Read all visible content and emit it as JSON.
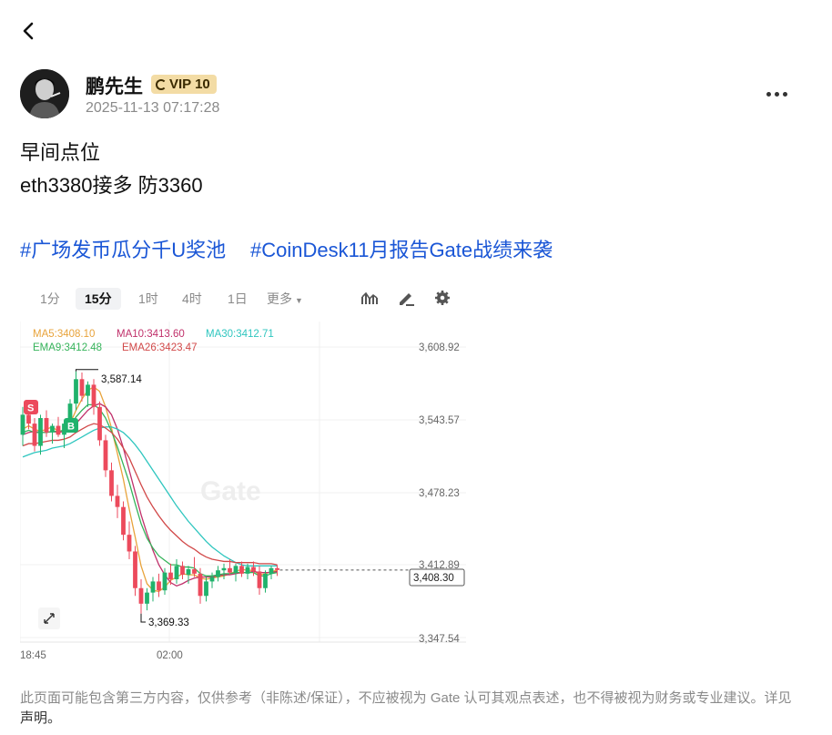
{
  "header": {
    "back_icon": "chevron-left-icon",
    "more_icon": "more-horizontal-icon"
  },
  "author": {
    "name": "鹏先生",
    "vip_label": "VIP 10",
    "timestamp": "2025-11-13 07:17:28"
  },
  "post": {
    "lines": [
      "早间点位",
      "eth3380接多 防3360"
    ],
    "hashtags": [
      "#广场发币瓜分千U奖池",
      "#CoinDesk11月报告Gate战绩来袭"
    ]
  },
  "chart_toolbar": {
    "timeframes": [
      "1分",
      "15分",
      "1时",
      "4时",
      "1日"
    ],
    "active_timeframe": "15分",
    "more_label": "更多",
    "tools": [
      "indicator-icon",
      "draw-pen-icon",
      "settings-gear-icon"
    ]
  },
  "chart_data": {
    "type": "candlestick",
    "watermark": "Gate",
    "indicators": {
      "row1": [
        {
          "label": "MA5:3408.10",
          "color": "#e8a33b"
        },
        {
          "label": "MA10:3413.60",
          "color": "#c0306a"
        },
        {
          "label": "MA30:3412.71",
          "color": "#2fc6bf"
        }
      ],
      "row2": [
        {
          "label": "EMA9:3412.48",
          "color": "#35b35a"
        },
        {
          "label": "EMA26:3423.47",
          "color": "#d14848"
        }
      ]
    },
    "y_ticks": [
      "3,608.92",
      "3,543.57",
      "3,478.23",
      "3,412.89",
      "3,347.54"
    ],
    "ylim": [
      3347.54,
      3608.92
    ],
    "x_ticks": [
      "18:45",
      "02:00"
    ],
    "current_price": "3,408.30",
    "annotations": {
      "high": "3,587.14",
      "low": "3,369.33"
    },
    "markers": [
      {
        "label": "S",
        "color": "#ec4a5c"
      },
      {
        "label": "B",
        "color": "#20b26c"
      }
    ],
    "candles": [
      [
        3530,
        3555,
        3520,
        3548
      ],
      [
        3548,
        3560,
        3535,
        3540
      ],
      [
        3540,
        3545,
        3515,
        3520
      ],
      [
        3520,
        3548,
        3512,
        3545
      ],
      [
        3545,
        3552,
        3528,
        3532
      ],
      [
        3532,
        3540,
        3522,
        3538
      ],
      [
        3538,
        3546,
        3528,
        3530
      ],
      [
        3530,
        3542,
        3518,
        3540
      ],
      [
        3540,
        3562,
        3535,
        3558
      ],
      [
        3558,
        3587,
        3552,
        3580
      ],
      [
        3580,
        3586,
        3560,
        3565
      ],
      [
        3565,
        3578,
        3555,
        3575
      ],
      [
        3575,
        3580,
        3548,
        3555
      ],
      [
        3555,
        3560,
        3520,
        3525
      ],
      [
        3525,
        3530,
        3492,
        3498
      ],
      [
        3498,
        3505,
        3470,
        3475
      ],
      [
        3475,
        3485,
        3455,
        3465
      ],
      [
        3465,
        3470,
        3435,
        3440
      ],
      [
        3440,
        3452,
        3418,
        3425
      ],
      [
        3425,
        3430,
        3385,
        3392
      ],
      [
        3392,
        3400,
        3369,
        3378
      ],
      [
        3378,
        3392,
        3372,
        3388
      ],
      [
        3388,
        3402,
        3380,
        3398
      ],
      [
        3398,
        3405,
        3384,
        3390
      ],
      [
        3390,
        3410,
        3386,
        3406
      ],
      [
        3406,
        3414,
        3395,
        3400
      ],
      [
        3400,
        3418,
        3396,
        3412
      ],
      [
        3412,
        3416,
        3400,
        3404
      ],
      [
        3404,
        3412,
        3396,
        3409
      ],
      [
        3409,
        3420,
        3402,
        3405
      ],
      [
        3405,
        3410,
        3378,
        3385
      ],
      [
        3385,
        3402,
        3380,
        3398
      ],
      [
        3398,
        3406,
        3392,
        3402
      ],
      [
        3402,
        3412,
        3398,
        3408
      ],
      [
        3408,
        3414,
        3400,
        3410
      ],
      [
        3410,
        3418,
        3404,
        3406
      ],
      [
        3406,
        3414,
        3398,
        3412
      ],
      [
        3412,
        3416,
        3402,
        3405
      ],
      [
        3405,
        3414,
        3400,
        3411
      ],
      [
        3411,
        3416,
        3403,
        3407
      ],
      [
        3407,
        3412,
        3386,
        3392
      ],
      [
        3392,
        3408,
        3388,
        3405
      ],
      [
        3405,
        3412,
        3400,
        3410
      ],
      [
        3410,
        3413,
        3403,
        3408.3
      ]
    ],
    "series": [
      {
        "name": "MA5",
        "color": "#e8a33b",
        "values": [
          3535,
          3538,
          3535,
          3533,
          3535,
          3537,
          3533,
          3534,
          3540,
          3552,
          3562,
          3570,
          3573,
          3569,
          3555,
          3536,
          3513,
          3490,
          3463,
          3438,
          3412,
          3396,
          3390,
          3389,
          3393,
          3399,
          3402,
          3405,
          3404,
          3404,
          3401,
          3400,
          3401,
          3402,
          3403,
          3405,
          3407,
          3409,
          3408,
          3408,
          3404,
          3405,
          3407,
          3408
        ]
      },
      {
        "name": "MA10",
        "color": "#c0306a",
        "values": [
          3530,
          3532,
          3533,
          3532,
          3532,
          3533,
          3532,
          3533,
          3536,
          3540,
          3546,
          3552,
          3556,
          3558,
          3555,
          3548,
          3535,
          3518,
          3498,
          3478,
          3458,
          3441,
          3426,
          3413,
          3404,
          3397,
          3394,
          3396,
          3399,
          3401,
          3402,
          3402,
          3402,
          3403,
          3404,
          3404,
          3405,
          3406,
          3406,
          3407,
          3406,
          3406,
          3406,
          3407
        ]
      },
      {
        "name": "MA30",
        "color": "#2fc6bf",
        "values": [
          3510,
          3512,
          3514,
          3515,
          3516,
          3518,
          3519,
          3520,
          3522,
          3525,
          3528,
          3531,
          3534,
          3536,
          3537,
          3537,
          3535,
          3532,
          3527,
          3521,
          3514,
          3506,
          3498,
          3490,
          3482,
          3474,
          3466,
          3459,
          3452,
          3446,
          3440,
          3434,
          3429,
          3425,
          3421,
          3418,
          3415,
          3413,
          3412,
          3412,
          3412,
          3412,
          3412,
          3412
        ]
      },
      {
        "name": "EMA9",
        "color": "#35b35a",
        "values": [
          3532,
          3534,
          3532,
          3532,
          3532,
          3533,
          3533,
          3534,
          3538,
          3546,
          3552,
          3557,
          3557,
          3553,
          3545,
          3533,
          3519,
          3503,
          3487,
          3468,
          3450,
          3437,
          3428,
          3421,
          3417,
          3413,
          3413,
          3411,
          3411,
          3410,
          3405,
          3403,
          3403,
          3404,
          3405,
          3405,
          3406,
          3406,
          3406,
          3406,
          3403,
          3403,
          3405,
          3406
        ]
      },
      {
        "name": "EMA26",
        "color": "#d14848",
        "values": [
          3520,
          3522,
          3522,
          3523,
          3524,
          3525,
          3525,
          3526,
          3528,
          3532,
          3535,
          3538,
          3540,
          3539,
          3536,
          3532,
          3526,
          3518,
          3509,
          3497,
          3485,
          3474,
          3465,
          3457,
          3450,
          3444,
          3439,
          3434,
          3430,
          3427,
          3423,
          3420,
          3418,
          3417,
          3416,
          3416,
          3415,
          3415,
          3415,
          3415,
          3414,
          3414,
          3414,
          3413
        ]
      }
    ]
  },
  "disclaimer": {
    "text": "此页面可能包含第三方内容，仅供参考（非陈述/保证），不应被视为 Gate 认可其观点表述，也不得被视为财务或专业建议。详见",
    "link": "声明。"
  }
}
